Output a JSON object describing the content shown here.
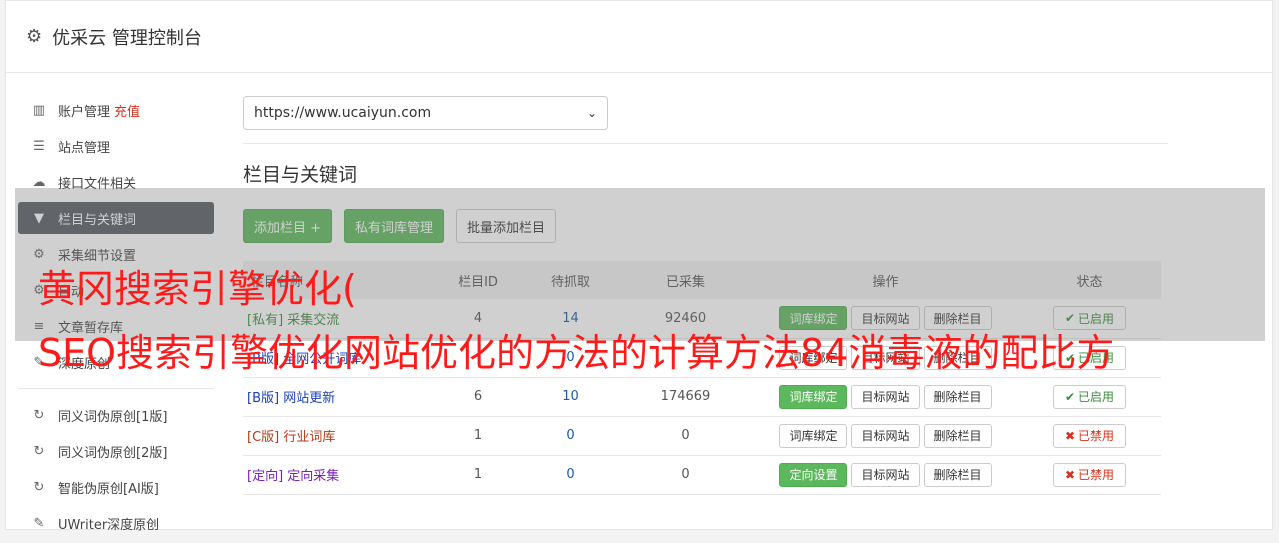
{
  "header": {
    "title": "优采云 管理控制台",
    "icon": "gear-icon"
  },
  "sidebar": {
    "items": [
      {
        "label": "账户管理",
        "extra": "充值",
        "icon": "bar-chart-icon"
      },
      {
        "label": "站点管理",
        "icon": "server-icon"
      },
      {
        "label": "接口文件相关",
        "icon": "cloud-upload-icon"
      },
      {
        "label": "栏目与关键词",
        "icon": "filter-icon",
        "active": true
      },
      {
        "label": "采集细节设置",
        "icon": "cogs-icon"
      },
      {
        "label": "自动",
        "icon": "cogs-icon"
      },
      {
        "label": "文章暂存库",
        "icon": "database-icon"
      },
      {
        "label": "深度原创",
        "icon": "edit-icon"
      }
    ],
    "items2": [
      {
        "label": "同义词伪原创[1版]",
        "icon": "refresh-icon"
      },
      {
        "label": "同义词伪原创[2版]",
        "icon": "refresh-icon"
      },
      {
        "label": "智能伪原创[AI版]",
        "icon": "refresh-icon"
      },
      {
        "label": "UWriter深度原创",
        "icon": "edit-icon"
      }
    ]
  },
  "main": {
    "site_select": "https://www.ucaiyun.com",
    "section_title": "栏目与关键词",
    "buttons": {
      "add": "添加栏目 +",
      "private_lib": "私有词库管理",
      "batch_add": "批量添加栏目"
    },
    "table": {
      "headers": [
        "栏目名称",
        "栏目ID",
        "待抓取",
        "已采集",
        "操作",
        "状态"
      ],
      "rows": [
        {
          "tag": "[私有]",
          "name": "采集交流",
          "id": "4",
          "pending": "14",
          "collected": "92460",
          "op1": "词库绑定",
          "op1_green": true,
          "op2": "目标网站",
          "op3": "删除栏目",
          "status": "已启用",
          "status_on": true,
          "tag_class": "tag-priv"
        },
        {
          "tag": "[B版]",
          "name": "全网公开词库",
          "id": "",
          "pending": "0",
          "collected": "",
          "op1": "词库绑定",
          "op1_green": false,
          "op2": "目标网站",
          "op3": "删除栏目",
          "status": "已启用",
          "status_on": true,
          "tag_class": "tag-b"
        },
        {
          "tag": "[B版]",
          "name": "网站更新",
          "id": "6",
          "pending": "10",
          "collected": "174669",
          "op1": "词库绑定",
          "op1_green": true,
          "op2": "目标网站",
          "op3": "删除栏目",
          "status": "已启用",
          "status_on": true,
          "tag_class": "tag-b"
        },
        {
          "tag": "[C版]",
          "name": "行业词库",
          "id": "1",
          "pending": "0",
          "collected": "0",
          "op1": "词库绑定",
          "op1_green": false,
          "op2": "目标网站",
          "op3": "删除栏目",
          "status": "已禁用",
          "status_on": false,
          "tag_class": "tag-c"
        },
        {
          "tag": "[定向]",
          "name": "定向采集",
          "id": "1",
          "pending": "0",
          "collected": "0",
          "op1": "定向设置",
          "op1_green": true,
          "op2": "目标网站",
          "op3": "删除栏目",
          "status": "已禁用",
          "status_on": false,
          "tag_class": "tag-d"
        }
      ]
    }
  },
  "overlay": {
    "line1": "黄冈搜索引擎优化(",
    "line2": "SEO搜索引擎优化网站优化的方法的计算方法84消毒液的配比方"
  },
  "colors": {
    "green": "#5cb85c",
    "active_nav": "#555b61",
    "spam_red": "#ff1a1a"
  }
}
